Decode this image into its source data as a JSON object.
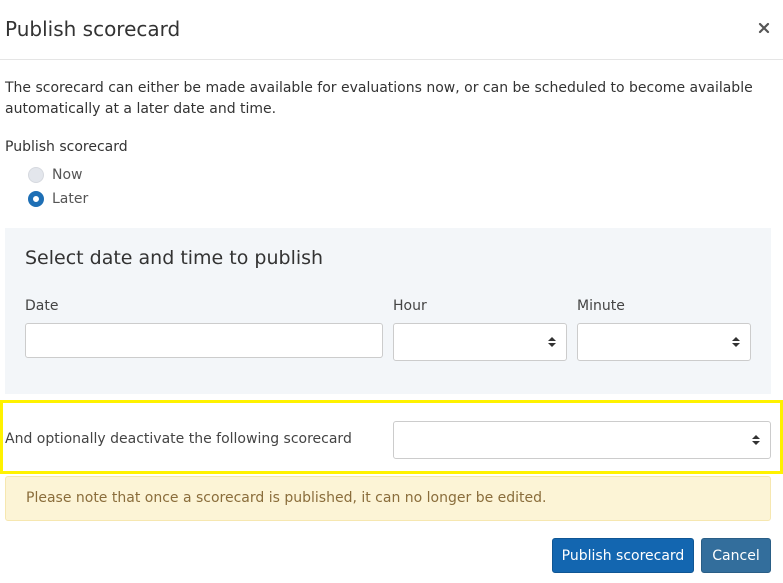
{
  "dialog": {
    "title": "Publish scorecard",
    "close_icon": "×",
    "intro": "The scorecard can either be made available for evaluations now, or can be scheduled to become available automatically at a later date and time."
  },
  "publish": {
    "label": "Publish scorecard",
    "options": [
      {
        "label": "Now",
        "selected": false
      },
      {
        "label": "Later",
        "selected": true
      }
    ]
  },
  "schedule": {
    "title": "Select date and time to publish",
    "date_label": "Date",
    "date_value": "",
    "hour_label": "Hour",
    "hour_value": "",
    "minute_label": "Minute",
    "minute_value": ""
  },
  "deactivate": {
    "label": "And optionally deactivate the following scorecard",
    "value": "",
    "highlight_color": "#fff200"
  },
  "alert": {
    "text": "Please note that once a scorecard is published, it can no longer be edited."
  },
  "buttons": {
    "publish": "Publish scorecard",
    "cancel": "Cancel"
  },
  "colors": {
    "primary": "#1366b0",
    "alert_bg": "#fcf4d6",
    "panel_bg": "#f3f6f9"
  }
}
